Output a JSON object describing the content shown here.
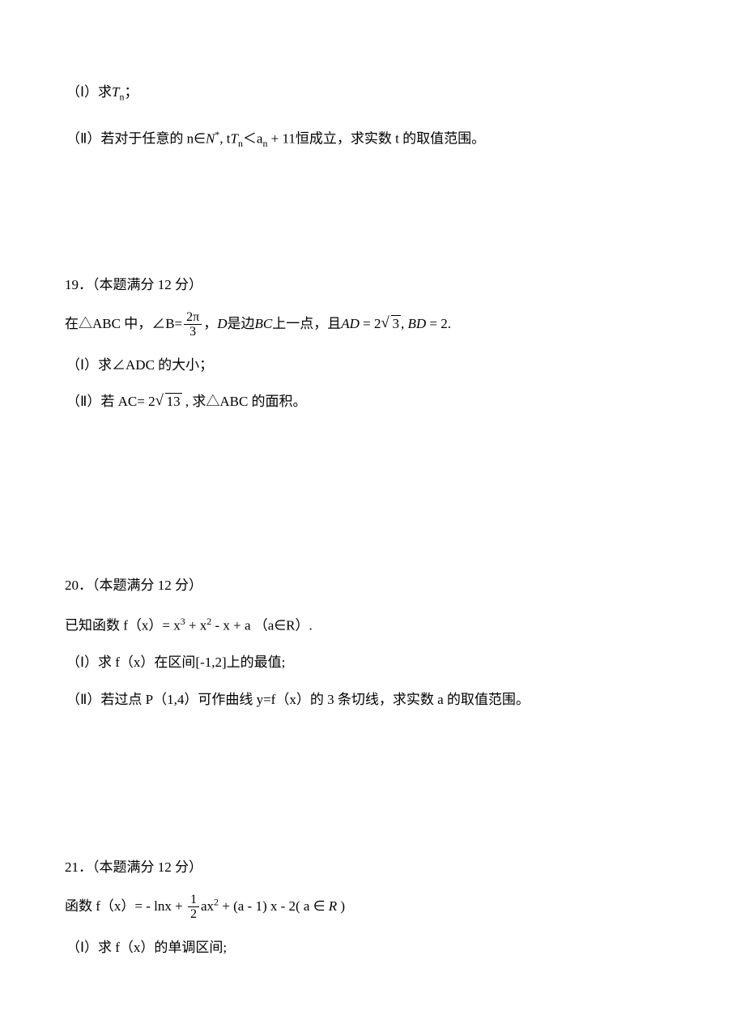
{
  "problem18": {
    "part1": "（Ⅰ）求",
    "part1_math_T": "T",
    "part1_math_n": "n",
    "part1_end": "；",
    "part2_pre": "（Ⅱ）若对于任意的 n∈",
    "part2_N": "N",
    "part2_star": "*",
    "part2_comma": ", t",
    "part2_T": "T",
    "part2_n": "n",
    "part2_lt": "＜a",
    "part2_an_n": "n",
    "part2_plus": " + 11",
    "part2_post": "恒成立，求实数 t 的取值范围。"
  },
  "problem19": {
    "number": "19．",
    "points": "（本题满分 12 分）",
    "stem_pre": "在△ABC 中，∠B=",
    "frac_num": "2π",
    "frac_den": "3",
    "stem_mid": "，",
    "stem_D": "D",
    "stem_BCpart": "是边",
    "stem_BC": "BC",
    "stem_point": "上一点，且",
    "stem_AD": "AD",
    "stem_eq1": " = 2",
    "stem_sqrt3": "3",
    "stem_comma2": ",  ",
    "stem_BD": "BD",
    "stem_eq2": " = 2.",
    "part1": "（Ⅰ）求∠ADC 的大小；",
    "part2_pre": "（Ⅱ）若 AC= 2",
    "part2_sqrt13": "13",
    "part2_post": " , 求△ABC 的面积。"
  },
  "problem20": {
    "number": "20．",
    "points": "（本题满分 12 分）",
    "stem_pre": "已知函数 f（x）= x",
    "exp3": "3",
    "plus1": " + x",
    "exp2": "2",
    "rest": " - x + a （a∈R）.",
    "part1": "（Ⅰ）求 f（x）在区间[-1,2]上的最值;",
    "part2": "（Ⅱ）若过点 P（1,4）可作曲线 y=f（x）的 3 条切线，求实数 a 的取值范围。"
  },
  "problem21": {
    "number": "21．",
    "points": "（本题满分 12 分）",
    "stem_pre": "函数 f（x）= - lnx + ",
    "frac_num": "1",
    "frac_den": "2",
    "stem_mid": "ax",
    "exp2": "2",
    "stem_rest": " + (a - 1) x - 2( a ∈ ",
    "R": "R",
    "stem_end": " )",
    "part1": "（Ⅰ）求 f（x）的单调区间;"
  }
}
